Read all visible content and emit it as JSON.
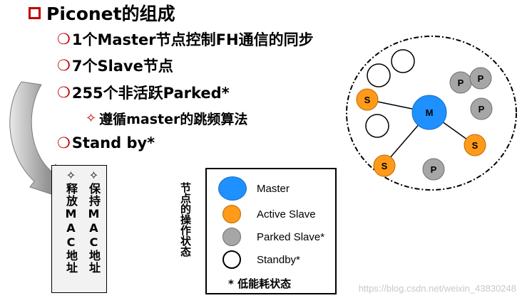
{
  "title": "Piconet的组成",
  "bullets": [
    "1个Master节点控制FH通信的同步",
    "7个Slave节点",
    "255个非活跃Parked*",
    "Stand by*"
  ],
  "subbullet": "遵循master的跳频算法",
  "side_box": {
    "col_hold": "✧保持MAC地址",
    "col_release": "✧释放MAC地址"
  },
  "state_label": "节点的操作状态",
  "legend": {
    "master": "Master",
    "active": "Active Slave",
    "parked": "Parked Slave*",
    "standby": "Standby*",
    "note": "* 低能耗状态"
  },
  "diagram": {
    "master_letter": "M",
    "slave_letter": "S",
    "parked_letter": "P"
  },
  "colors": {
    "accent_red": "#c00000",
    "master_blue": "#1e90ff",
    "slave_orange": "#ff9a1a",
    "parked_gray": "#a6a6a6"
  },
  "watermark": "https://blog.csdn.net/weixin_43830248"
}
